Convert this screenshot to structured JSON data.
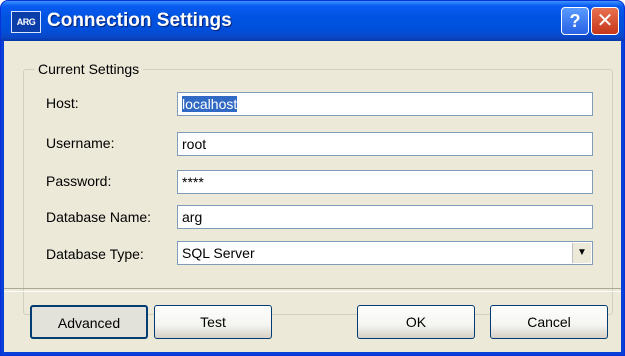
{
  "window": {
    "title": "Connection Settings",
    "app_icon_text": "ARG",
    "help_glyph": "?",
    "close_glyph": "✕"
  },
  "group": {
    "legend": "Current Settings"
  },
  "fields": {
    "host": {
      "label": "Host:",
      "value": "localhost",
      "selected": true
    },
    "username": {
      "label": "Username:",
      "value": "root"
    },
    "password": {
      "label": "Password:",
      "value": "****"
    },
    "database_name": {
      "label": "Database Name:",
      "value": "arg"
    },
    "database_type": {
      "label": "Database Type:",
      "value": "SQL Server",
      "arrow": "▼"
    }
  },
  "buttons": {
    "advanced": "Advanced",
    "test": "Test",
    "ok": "OK",
    "cancel": "Cancel"
  },
  "colors": {
    "titlebar": "#0053e1",
    "dialog_bg": "#ece9d8",
    "selection": "#316ac5"
  }
}
